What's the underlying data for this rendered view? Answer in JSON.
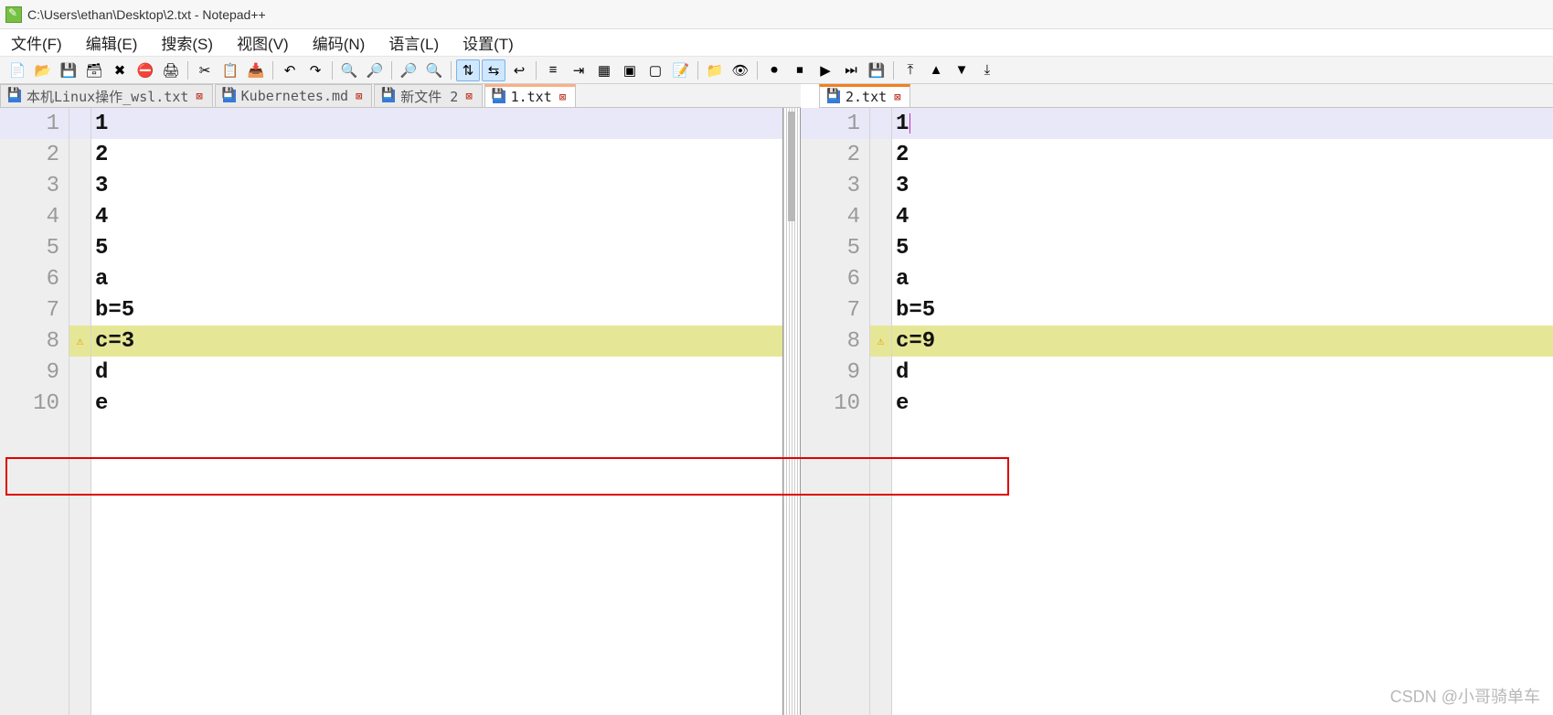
{
  "title_bar": {
    "text": "C:\\Users\\ethan\\Desktop\\2.txt - Notepad++"
  },
  "menu": {
    "file": "文件(F)",
    "edit": "编辑(E)",
    "search": "搜索(S)",
    "view": "视图(V)",
    "encoding": "编码(N)",
    "language": "语言(L)",
    "settings": "设置(T)"
  },
  "toolbar_icons": [
    "new-file",
    "open",
    "save",
    "save-all",
    "close",
    "close-all",
    "print",
    "sep",
    "cut",
    "copy",
    "paste",
    "sep",
    "undo",
    "redo",
    "sep",
    "find",
    "replace",
    "sep",
    "zoom-in",
    "zoom-out",
    "sep",
    "sync-v",
    "sync-h",
    "wrap",
    "sep",
    "toggle-all",
    "indent",
    "guide",
    "fold",
    "unfold",
    "comment",
    "sep",
    "folder",
    "eye",
    "sep",
    "record",
    "stop",
    "play",
    "play-multi",
    "save-macro",
    "sep",
    "sort-asc",
    "up",
    "down",
    "sort-desc"
  ],
  "tabs_left": [
    {
      "label": "本机Linux操作_wsl.txt",
      "active": false
    },
    {
      "label": "Kubernetes.md",
      "active": false
    },
    {
      "label": "新文件 2",
      "active": false
    },
    {
      "label": "1.txt",
      "active": true
    }
  ],
  "tabs_right": [
    {
      "label": "2.txt",
      "active": true
    }
  ],
  "editor_left": {
    "lines": [
      "1",
      "2",
      "3",
      "4",
      "5",
      "a",
      "b=5",
      "c=3",
      "d",
      "e"
    ],
    "diff_line_index": 7,
    "current_line_index": 0
  },
  "editor_right": {
    "lines": [
      "1",
      "2",
      "3",
      "4",
      "5",
      "a",
      "b=5",
      "c=9",
      "d",
      "e"
    ],
    "diff_line_index": 7,
    "current_line_index": 0
  },
  "watermark": "CSDN @小哥骑单车"
}
